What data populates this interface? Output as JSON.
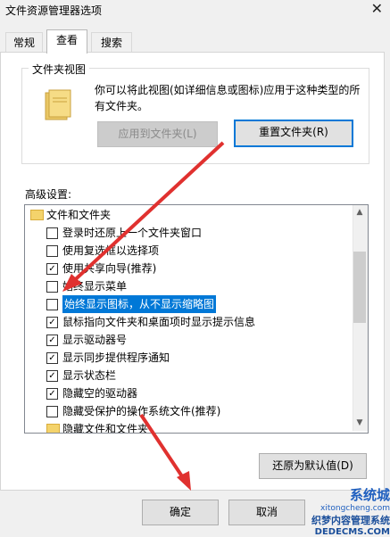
{
  "window": {
    "title": "文件资源管理器选项",
    "close_glyph": "✕"
  },
  "tabs": [
    {
      "label": "常规"
    },
    {
      "label": "查看"
    },
    {
      "label": "搜索"
    }
  ],
  "folder_views": {
    "group_label": "文件夹视图",
    "description": "你可以将此视图(如详细信息或图标)应用于这种类型的所有文件夹。",
    "apply_button": "应用到文件夹(L)",
    "reset_button": "重置文件夹(R)"
  },
  "advanced": {
    "label": "高级设置:",
    "items": [
      {
        "label": "文件和文件夹",
        "type": "folder"
      },
      {
        "label": "登录时还原上一个文件夹窗口",
        "checked": false
      },
      {
        "label": "使用复选框以选择项",
        "checked": false
      },
      {
        "label": "使用共享向导(推荐)",
        "checked": true
      },
      {
        "label": "始终显示菜单",
        "checked": false
      },
      {
        "label": "始终显示图标，从不显示缩略图",
        "checked": false,
        "selected": true
      },
      {
        "label": "鼠标指向文件夹和桌面项时显示提示信息",
        "checked": true
      },
      {
        "label": "显示驱动器号",
        "checked": true
      },
      {
        "label": "显示同步提供程序通知",
        "checked": true
      },
      {
        "label": "显示状态栏",
        "checked": true
      },
      {
        "label": "隐藏空的驱动器",
        "checked": true
      },
      {
        "label": "隐藏受保护的操作系统文件(推荐)",
        "checked": false
      },
      {
        "label": "隐藏文件和文件夹",
        "type": "folder"
      }
    ],
    "restore_button": "还原为默认值(D)"
  },
  "footer": {
    "ok_button": "确定",
    "cancel_button": "取消"
  },
  "watermark": {
    "line1": "系统城",
    "line2": "xitongcheng.com",
    "line3": "织梦内容管理系统",
    "line4": "DEDECMS.COM"
  },
  "colors": {
    "accent": "#0078d7",
    "arrow": "#e0312f"
  }
}
